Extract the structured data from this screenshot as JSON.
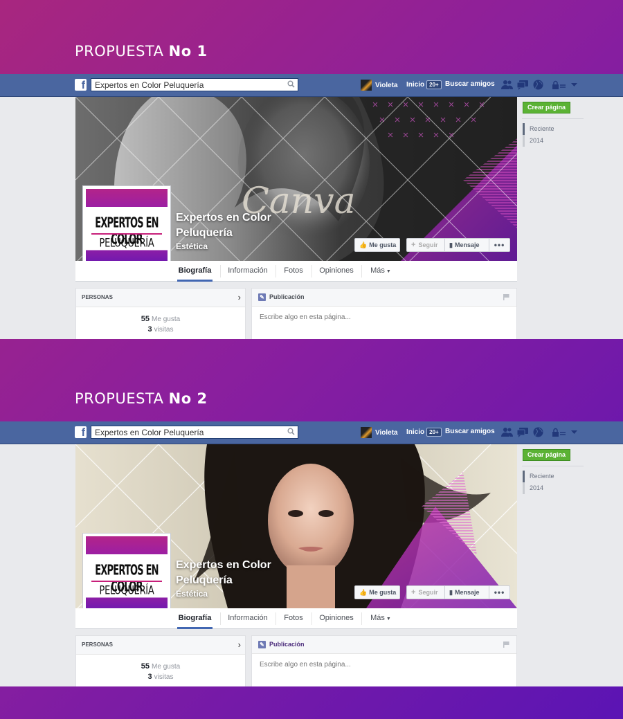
{
  "proposals": [
    {
      "title_prefix": "PROPUESTA",
      "title_bold": "No 1",
      "variant": "b&w portrait with Canva watermark",
      "watermark": "Canva"
    },
    {
      "title_prefix": "PROPUESTA",
      "title_bold": "No 2",
      "variant": "color portrait"
    }
  ],
  "topbar": {
    "logo": "f",
    "search_value": "Expertos en Color Peluquería",
    "user_name": "Violeta",
    "inicio_label": "Inicio",
    "inicio_count": "20+",
    "buscar_label": "Buscar amigos",
    "icons": [
      "friends-icon",
      "messages-icon",
      "globe-icon",
      "lock-icon",
      "caret-down-icon"
    ]
  },
  "page": {
    "name_line1": "Expertos en Color",
    "name_line2": "Peluquería",
    "category": "Estética",
    "logo_line1": "EXPERTOS EN COLOR",
    "logo_line2": "PELUQUERÍA",
    "buttons": {
      "like": "Me gusta",
      "follow": "Seguir",
      "message": "Mensaje",
      "more": "•••"
    },
    "tabs": [
      "Biografía",
      "Información",
      "Fotos",
      "Opiniones",
      "Más"
    ],
    "create_page": "Crear página",
    "timeline": [
      "Reciente",
      "2014"
    ],
    "personas": {
      "header": "PERSONAS",
      "likes_count": "55",
      "likes_label": "Me gusta",
      "visits_count": "3",
      "visits_label": "visitas"
    },
    "composer": {
      "header": "Publicación",
      "placeholder": "Escribe algo en esta página..."
    }
  },
  "colors": {
    "bg_start": "#a8267f",
    "bg_end": "#5b14b4",
    "fb_blue": "#4a66a0",
    "green": "#5bb234"
  }
}
